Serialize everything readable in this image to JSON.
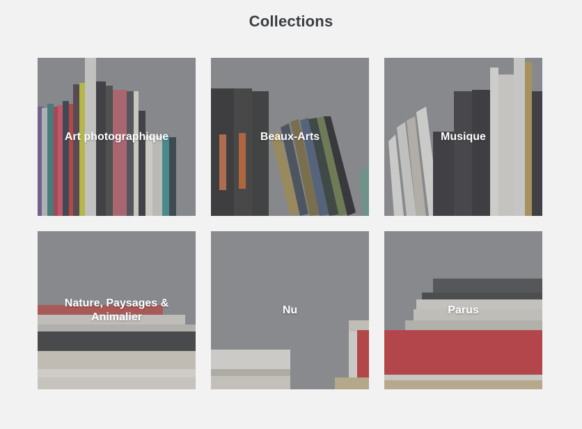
{
  "page": {
    "title": "Collections"
  },
  "collections": [
    {
      "label": "Art photographique",
      "image": "books-standing-colorful"
    },
    {
      "label": "Beaux-Arts",
      "image": "books-leaning-dark"
    },
    {
      "label": "Musique",
      "image": "books-leaning-white"
    },
    {
      "label": "Nature, Paysages & Animalier",
      "image": "books-stacked-horizontal"
    },
    {
      "label": "Nu",
      "image": "books-stacked-low"
    },
    {
      "label": "Parus",
      "image": "books-stacked-red"
    }
  ]
}
